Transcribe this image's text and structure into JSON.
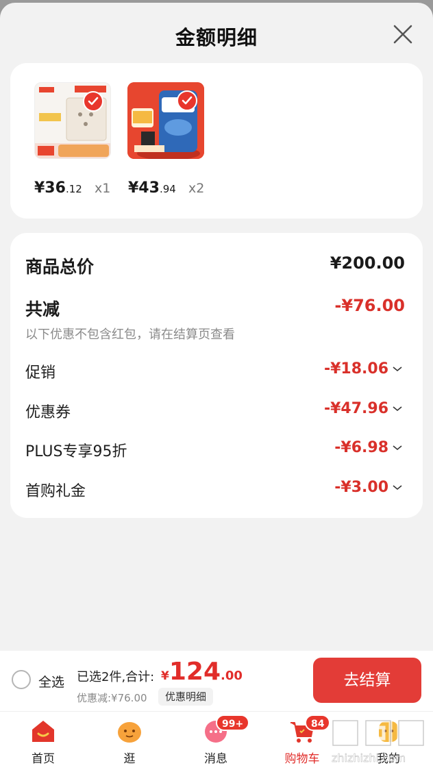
{
  "sheet": {
    "title": "金额明细"
  },
  "products": [
    {
      "price_int": "¥36",
      "price_dec": ".12",
      "qty": "x1",
      "thumb_icon": "switch-socket-product"
    },
    {
      "price_int": "¥43",
      "price_dec": ".94",
      "qty": "x2",
      "thumb_icon": "milk-powder-product"
    }
  ],
  "details": {
    "total_label": "商品总价",
    "total_value": "¥200.00",
    "reduce_label": "共减",
    "reduce_value": "-¥76.00",
    "note": "以下优惠不包含红包，请在结算页查看",
    "items": [
      {
        "label": "促销",
        "value": "-¥18.06"
      },
      {
        "label": "优惠券",
        "value": "-¥47.96"
      },
      {
        "label": "PLUS专享95折",
        "value": "-¥6.98"
      },
      {
        "label": "首购礼金",
        "value": "-¥3.00"
      }
    ]
  },
  "bottom_bar": {
    "select_all": "全选",
    "summary": "已选2件,合计:",
    "total_symbol": "¥",
    "total_int": "124",
    "total_dec": ".00",
    "discount": "优惠减:¥76.00",
    "detail_button": "优惠明细",
    "checkout": "去结算"
  },
  "tabbar": [
    {
      "label": "首页",
      "icon": "home-icon"
    },
    {
      "label": "逛",
      "icon": "browse-icon"
    },
    {
      "label": "消息",
      "icon": "message-icon",
      "badge": "99+"
    },
    {
      "label": "购物车",
      "icon": "cart-icon",
      "badge": "84",
      "active": true
    },
    {
      "label": "我的",
      "icon": "profile-icon"
    }
  ],
  "colors": {
    "accent": "#e12d2a",
    "checkout": "#e33c37",
    "text": "#1a1a1a"
  }
}
